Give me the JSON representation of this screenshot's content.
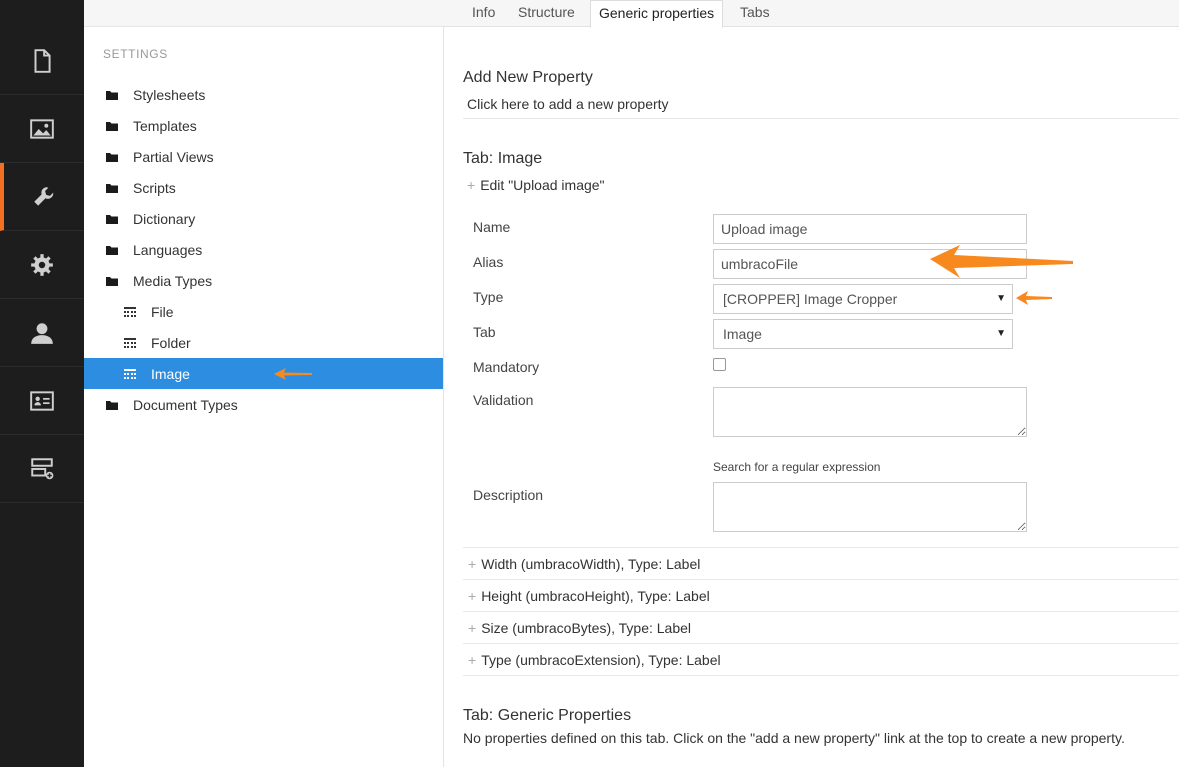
{
  "tabs": [
    {
      "label": "Info"
    },
    {
      "label": "Structure"
    },
    {
      "label": "Generic properties"
    },
    {
      "label": "Tabs"
    }
  ],
  "sidebar": {
    "heading": "SETTINGS",
    "items": [
      {
        "label": "Stylesheets",
        "icon": "folder-icon"
      },
      {
        "label": "Templates",
        "icon": "folder-icon"
      },
      {
        "label": "Partial Views",
        "icon": "folder-icon"
      },
      {
        "label": "Scripts",
        "icon": "folder-icon"
      },
      {
        "label": "Dictionary",
        "icon": "folder-icon"
      },
      {
        "label": "Languages",
        "icon": "folder-icon"
      },
      {
        "label": "Media Types",
        "icon": "folder-icon"
      },
      {
        "label": "File",
        "icon": "media-type-icon"
      },
      {
        "label": "Folder",
        "icon": "media-type-icon"
      },
      {
        "label": "Image",
        "icon": "media-type-icon",
        "selected": true
      },
      {
        "label": "Document Types",
        "icon": "folder-icon"
      }
    ]
  },
  "rail": {
    "icons": [
      "content-icon",
      "media-icon",
      "settings-wrench-icon",
      "developer-gear-icon",
      "users-icon",
      "members-icon",
      "forms-icon"
    ],
    "active_color": "#f36f21"
  },
  "main": {
    "add_new_property": {
      "title": "Add New Property",
      "link": "Click here to add a new property"
    },
    "tab_image": {
      "title": "Tab: Image",
      "edit_label": "Edit \"Upload image\"",
      "form": {
        "name_label": "Name",
        "name_value": "Upload image",
        "alias_label": "Alias",
        "alias_value": "umbracoFile",
        "type_label": "Type",
        "type_value": "[CROPPER] Image Cropper",
        "tab_label": "Tab",
        "tab_value": "Image",
        "mandatory_label": "Mandatory",
        "validation_label": "Validation",
        "regex_link": "Search for a regular expression",
        "description_label": "Description"
      },
      "properties": [
        {
          "label": "Width (umbracoWidth), Type: Label"
        },
        {
          "label": "Height (umbracoHeight), Type: Label"
        },
        {
          "label": "Size (umbracoBytes), Type: Label"
        },
        {
          "label": "Type (umbracoExtension), Type: Label"
        }
      ]
    },
    "tab_generic": {
      "title": "Tab: Generic Properties",
      "empty_text": "No properties defined on this tab. Click on the \"add a new property\" link at the top to create a new property."
    }
  },
  "colors": {
    "rail_bg": "#1d1d1d",
    "selected_bg": "#2d8de0",
    "annotation_arrow": "#f7891f"
  }
}
